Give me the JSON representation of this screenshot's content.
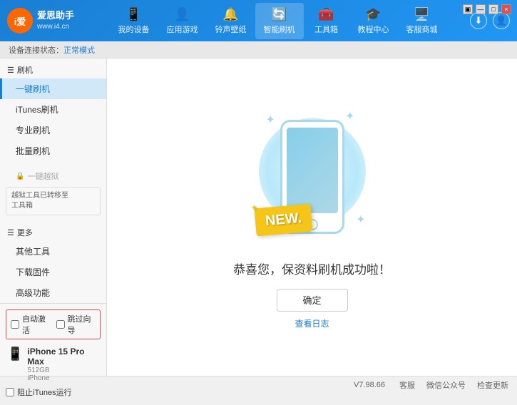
{
  "app": {
    "title": "爱思助手",
    "subtitle": "www.i4.cn",
    "logo_text": "iU"
  },
  "window_controls": {
    "minimize": "—",
    "restore": "□",
    "close": "×"
  },
  "nav": {
    "items": [
      {
        "id": "my-device",
        "label": "我的设备",
        "icon": "📱"
      },
      {
        "id": "apps-games",
        "label": "应用游戏",
        "icon": "👤"
      },
      {
        "id": "ringtones",
        "label": "铃声壁纸",
        "icon": "🔔"
      },
      {
        "id": "smart-flash",
        "label": "智能刷机",
        "icon": "🔄"
      },
      {
        "id": "toolbox",
        "label": "工具箱",
        "icon": "🧰"
      },
      {
        "id": "tutorial",
        "label": "教程中心",
        "icon": "🎓"
      },
      {
        "id": "service",
        "label": "客服商城",
        "icon": "🖥️"
      }
    ]
  },
  "header_right": {
    "download_icon": "⬇",
    "user_icon": "👤"
  },
  "breadcrumb": {
    "prefix": "设备连接状态：",
    "status": "正常模式"
  },
  "sidebar": {
    "flash_section": "刷机",
    "flash_items": [
      {
        "id": "one-click-flash",
        "label": "一键刷机",
        "active": true
      },
      {
        "id": "itunes-flash",
        "label": "iTunes刷机"
      },
      {
        "id": "pro-flash",
        "label": "专业刷机"
      },
      {
        "id": "batch-flash",
        "label": "批量刷机"
      }
    ],
    "disabled_item": {
      "label": "一键越狱",
      "icon": "🔒"
    },
    "warning_box": {
      "line1": "越狱工具已转移至",
      "line2": "工具箱"
    },
    "more_section": "更多",
    "more_items": [
      {
        "id": "other-tools",
        "label": "其他工具"
      },
      {
        "id": "download-firmware",
        "label": "下载固件"
      },
      {
        "id": "advanced",
        "label": "高级功能"
      }
    ],
    "auto_activate_label": "自动激活",
    "guide_activate_label": "跳过向导",
    "device": {
      "name": "iPhone 15 Pro Max",
      "storage": "512GB",
      "type": "iPhone",
      "icon": "📱"
    },
    "itunes_label": "阻止iTunes运行"
  },
  "main_content": {
    "success_text": "恭喜您，保资料刷机成功啦！",
    "confirm_button": "确定",
    "log_link": "查看日志",
    "new_badge": "NEW."
  },
  "footer": {
    "version": "V7.98.66",
    "items": [
      {
        "id": "desktop",
        "label": "客服"
      },
      {
        "id": "wechat",
        "label": "微信公众号"
      },
      {
        "id": "check-update",
        "label": "检查更新"
      }
    ]
  }
}
